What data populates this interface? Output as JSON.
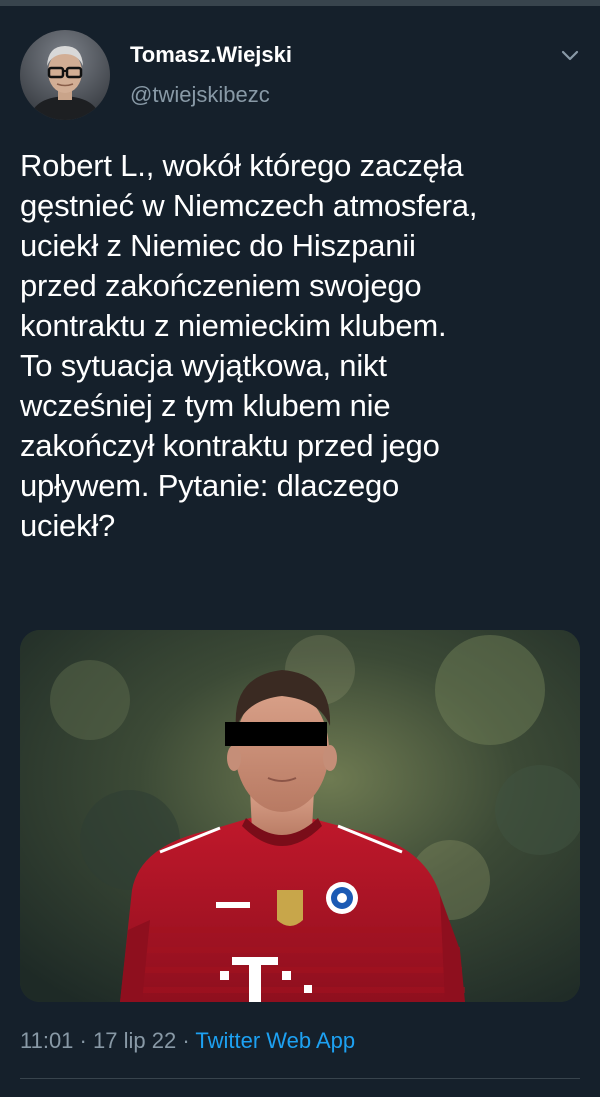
{
  "tweet": {
    "author": {
      "display_name": "Tomasz.Wiejski",
      "handle": "@twiejskibezc"
    },
    "text": "Robert L., wokół którego zaczęła\ngęstnieć w Niemczech atmosfera,\nuciekł z Niemiec do Hiszpanii\nprzed zakończeniem swojego\nkontraktu z niemieckim klubem.\nTo sytuacja wyjątkowa, nikt\nwcześniej z tym klubem  nie\nzakończył kontraktu przed jego\nupływem. Pytanie: dlaczego\nuciekł?",
    "meta": {
      "time": "11:01",
      "separator": "·",
      "date": "17 lip 22",
      "source": "Twitter Web App"
    }
  },
  "icons": {
    "more_menu": "chevron-down-icon"
  },
  "colors": {
    "background": "#15202b",
    "text_primary": "#ffffff",
    "text_secondary": "#8899a6",
    "link": "#1da1f2",
    "divider": "#38444d"
  }
}
